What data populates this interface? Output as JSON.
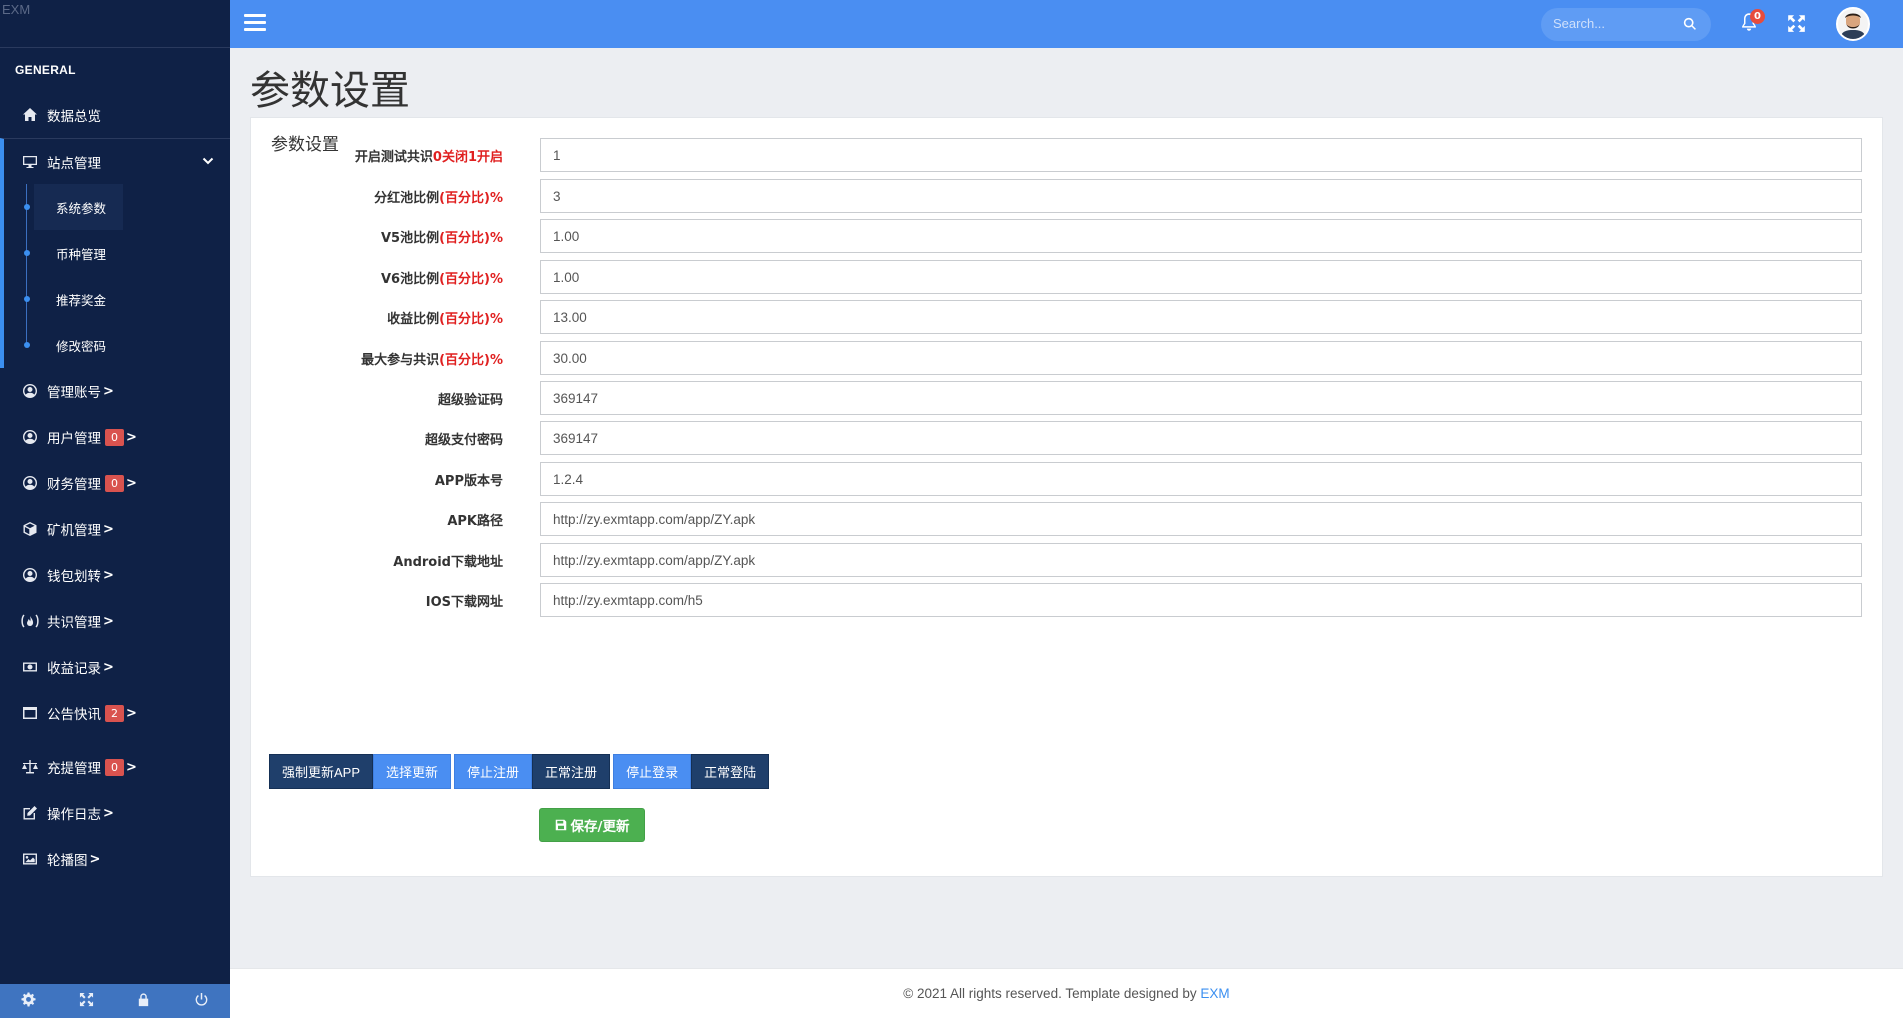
{
  "brand": "EXM",
  "sidebar": {
    "section": "GENERAL",
    "items": [
      {
        "label": "数据总览",
        "icon": "home-icon"
      },
      {
        "label": "站点管理",
        "icon": "monitor-icon"
      },
      {
        "label": "管理账号",
        "icon": "user-circle-icon",
        "arrow": ">"
      },
      {
        "label": "用户管理",
        "icon": "user-circle-icon",
        "badge": "0",
        "arrow": ">"
      },
      {
        "label": "财务管理",
        "icon": "user-circle-icon",
        "badge": "0",
        "arrow": ">"
      },
      {
        "label": "矿机管理",
        "icon": "cube-icon",
        "arrow": ">"
      },
      {
        "label": "钱包划转",
        "icon": "user-circle-icon",
        "arrow": ">"
      },
      {
        "label": "共识管理",
        "icon": "fire-icon",
        "arrow": ">"
      },
      {
        "label": "收益记录",
        "icon": "money-icon",
        "arrow": ">"
      },
      {
        "label": "公告快讯",
        "icon": "window-icon",
        "badge": "2",
        "arrow": ">"
      },
      {
        "label": "充提管理",
        "icon": "scale-icon",
        "badge": "0",
        "arrow": ">"
      },
      {
        "label": "操作日志",
        "icon": "edit-icon",
        "arrow": ">"
      },
      {
        "label": "轮播图",
        "icon": "image-icon",
        "arrow": ">"
      }
    ],
    "submenu": [
      "系统参数",
      "币种管理",
      "推荐奖金",
      "修改密码"
    ]
  },
  "topbar": {
    "search_placeholder": "Search...",
    "notifications": "0"
  },
  "page": {
    "title": "参数设置",
    "panel_title": "参数设置"
  },
  "form": {
    "fields": [
      {
        "label": "开启测试共识",
        "red": "0关闭1开启",
        "suffix": "",
        "value": "1"
      },
      {
        "label": "分红池比例",
        "red": "(百分比)%",
        "suffix": "",
        "value": "3"
      },
      {
        "label": "V5池比例",
        "red": "(百分比)%",
        "suffix": "",
        "value": "1.00"
      },
      {
        "label": "V6池比例",
        "red": "(百分比)%",
        "suffix": "",
        "value": "1.00"
      },
      {
        "label": "收益比例",
        "red": "(百分比)%",
        "suffix": "",
        "value": "13.00"
      },
      {
        "label": "最大参与共识",
        "red": "(百分比)%",
        "suffix": "",
        "value": "30.00"
      },
      {
        "label": "超级验证码",
        "red": "",
        "suffix": "",
        "value": "369147"
      },
      {
        "label": "超级支付密码",
        "red": "",
        "suffix": "",
        "value": "369147"
      },
      {
        "label": "APP版本号",
        "red": "",
        "suffix": "",
        "value": "1.2.4"
      },
      {
        "label": "APK路径",
        "red": "",
        "suffix": "",
        "value": "http://zy.exmtapp.com/app/ZY.apk"
      },
      {
        "label": "Android下载地址",
        "red": "",
        "suffix": "",
        "value": "http://zy.exmtapp.com/app/ZY.apk"
      },
      {
        "label": "IOS下载网址",
        "red": "",
        "suffix": "",
        "value": "http://zy.exmtapp.com/h5"
      }
    ],
    "buttons": [
      {
        "label": "强制更新APP",
        "style": "dark"
      },
      {
        "label": "选择更新",
        "style": "light"
      },
      {
        "label": "停止注册",
        "style": "light"
      },
      {
        "label": "正常注册",
        "style": "dark"
      },
      {
        "label": "停止登录",
        "style": "light"
      },
      {
        "label": "正常登陆",
        "style": "dark"
      }
    ],
    "save_label": "保存/更新"
  },
  "footer": {
    "text": "© 2021 All rights reserved. Template designed by ",
    "link": "EXM"
  }
}
